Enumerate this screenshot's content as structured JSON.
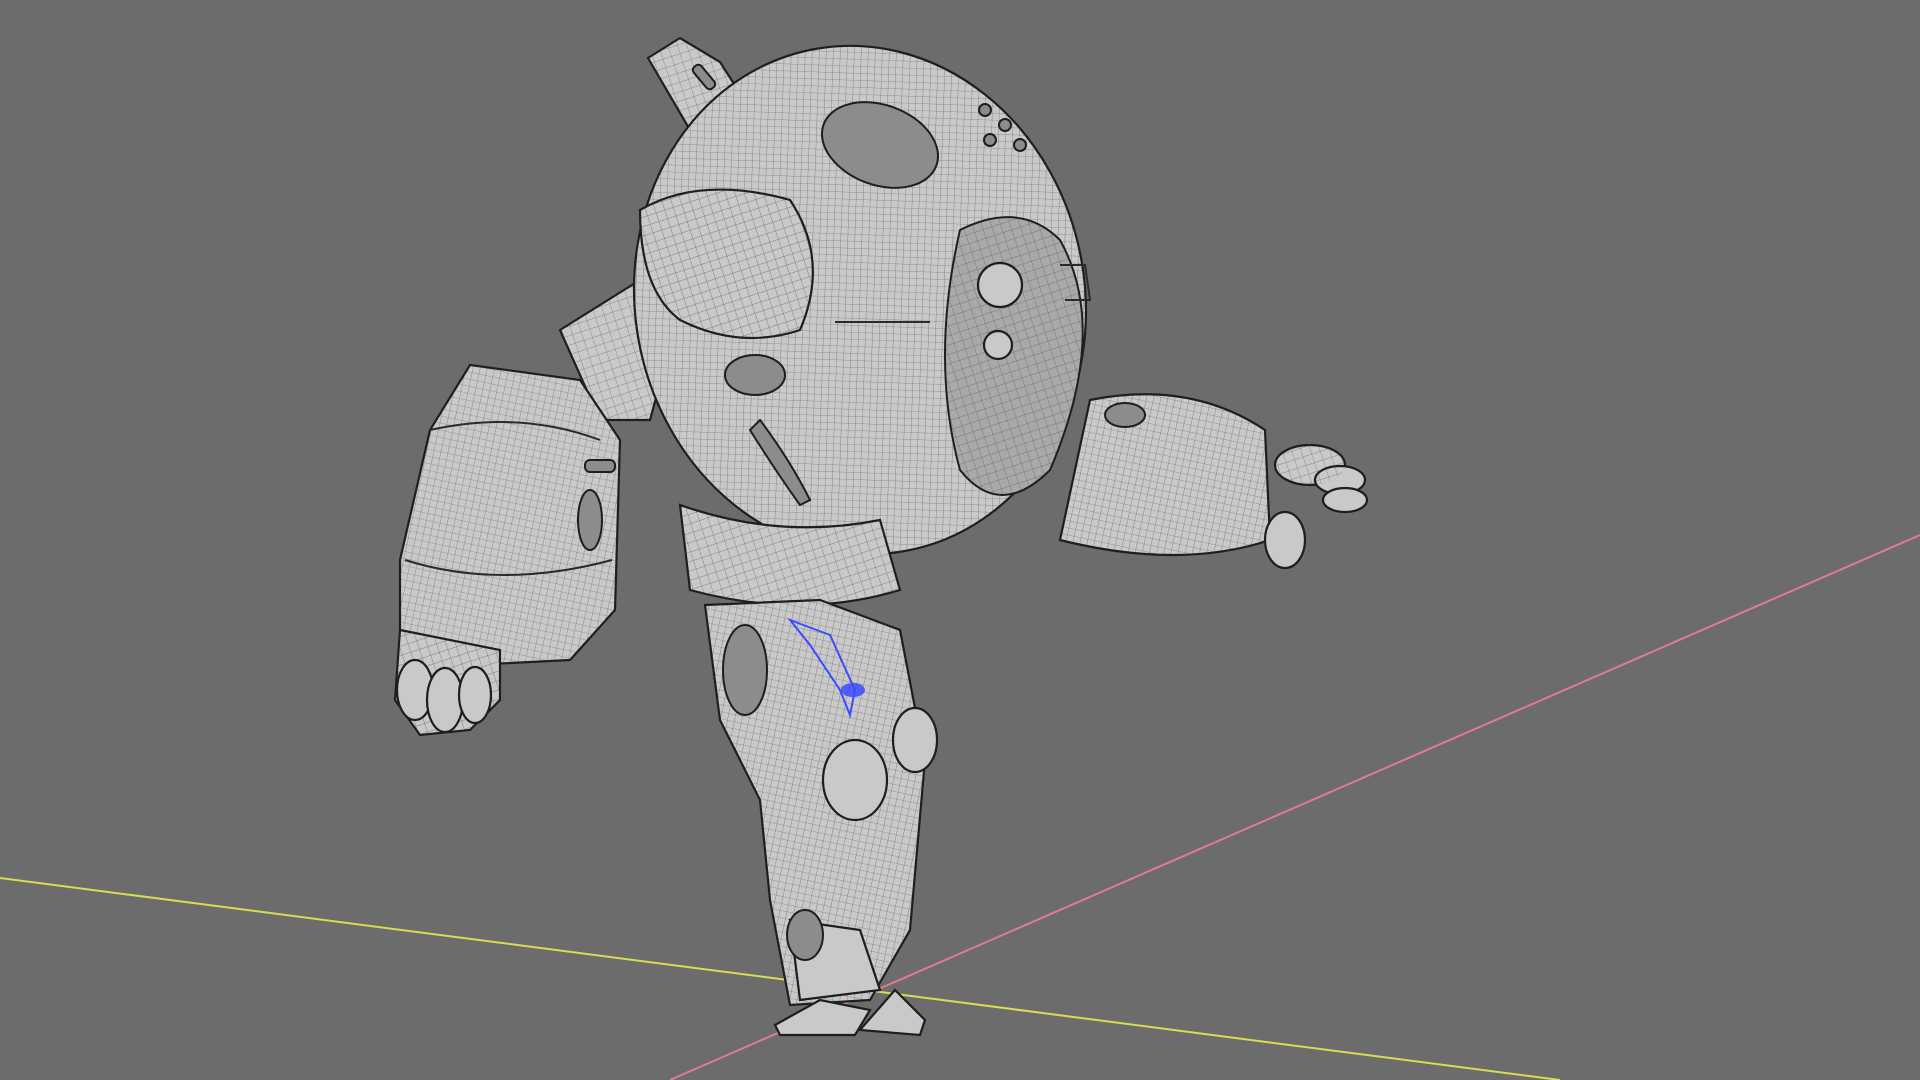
{
  "viewport": {
    "label": "",
    "background": "#6c6c6c",
    "axis_x_color": "#e07a95",
    "axis_y_color": "#d8dc52",
    "selection_color": "#3b4bff",
    "object": "robot-wireframe-mesh"
  }
}
